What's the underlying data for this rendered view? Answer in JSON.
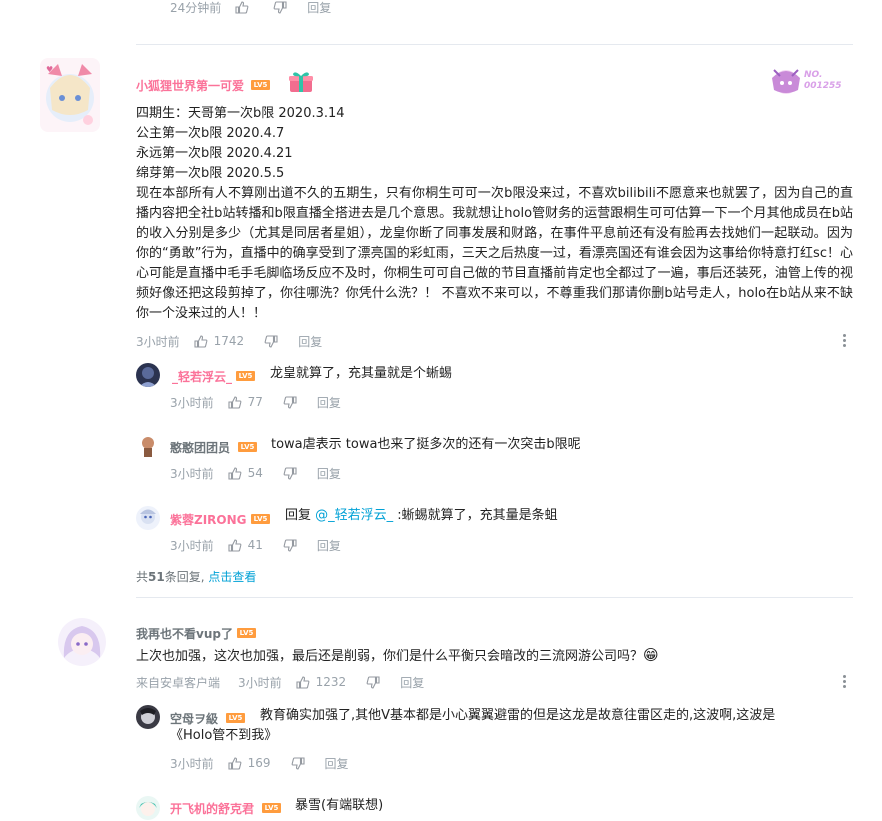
{
  "top_meta": {
    "time": "24分钟前",
    "reply": "回复"
  },
  "comment1": {
    "username": "小狐狸世界第一可爱",
    "level": "LV5",
    "badge_no": "NO.",
    "badge_num": "001255",
    "lines": [
      "四期生：天哥第一次b限 2020.3.14",
      "公主第一次b限 2020.4.7",
      "永远第一次b限 2020.4.21",
      "绵芽第一次b限 2020.5.5"
    ],
    "paragraph": "现在本部所有人不算刚出道不久的五期生，只有你桐生可可一次b限没来过，不喜欢bilibili不愿意来也就罢了，因为自己的直播内容把全社b站转播和b限直播全搭进去是几个意思。我就想让holo管财务的运营跟桐生可可估算一下一个月其他成员在b站的收入分别是多少（尤其是同居者星姐），龙皇你断了同事发展和财路，在事件平息前还有没有脸再去找她们一起联动。因为你的“勇敢”行为，直播中的确享受到了漂亮国的彩虹雨，三天之后热度一过，看漂亮国还有谁会因为这事给你特意打红sc！心心可能是直播中毛手毛脚临场反应不及时，你桐生可可自己做的节目直播前肯定也全都过了一遍，事后还装死，油管上传的视频好像还把这段剪掉了，你往哪洗？你凭什么洗？！ 不喜欢不来可以，不尊重我们那请你删b站号走人，holo在b站从来不缺你一个没来过的人！！",
    "time": "3小时前",
    "likes": "1742",
    "reply": "回复"
  },
  "replies1": [
    {
      "username": "_轻若浮云_",
      "level": "LV5",
      "text": "龙皇就算了，充其量就是个蜥蜴",
      "time": "3小时前",
      "likes": "77",
      "reply": "回复"
    },
    {
      "username": "憨憨团团员",
      "level": "LV5",
      "text": "towa虐表示 towa也来了挺多次的还有一次突击b限呢",
      "time": "3小时前",
      "likes": "54",
      "reply": "回复"
    },
    {
      "username": "紫蓉ZIRONG",
      "level": "LV5",
      "prefix": "回复 ",
      "at": "@_轻若浮云_",
      "text": " :蜥蜴就算了，充其量是条蛆",
      "time": "3小时前",
      "likes": "41",
      "reply": "回复"
    }
  ],
  "reply_summary": {
    "prefix": "共",
    "count": "51",
    "suffix": "条回复, ",
    "link": "点击查看"
  },
  "comment2": {
    "username": "我再也不看vup了",
    "level": "LV5",
    "text": "上次也加强，这次也加强，最后还是削弱，你们是什么平衡只会暗改的三流网游公司吗？",
    "emoji": "😁",
    "source": "来自安卓客户端",
    "time": "3小时前",
    "likes": "1232",
    "reply": "回复"
  },
  "replies2": [
    {
      "username": "空母ヲ級",
      "level": "LV5",
      "line1": "教育确实加强了,其他V基本都是小心翼翼避雷的但是这龙是故意往雷区走的,这波啊,这波是",
      "line2": "《Holo管不到我》",
      "time": "3小时前",
      "likes": "169",
      "reply": "回复"
    },
    {
      "username": "开飞机的舒克君",
      "level": "LV5",
      "text": "暴雪(有端联想)"
    }
  ]
}
